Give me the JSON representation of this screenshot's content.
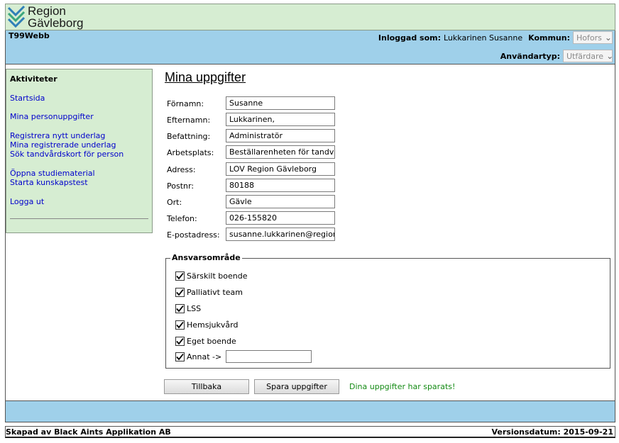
{
  "logo": {
    "line1": "Region",
    "line2": "Gävleborg"
  },
  "header": {
    "app_name": "T99Webb",
    "logged_in_label": "Inloggad som:",
    "logged_in_user": "Lukkarinen Susanne",
    "kommun_label": "Kommun:",
    "kommun_value": "Hofors",
    "usertype_label": "Användartyp:",
    "usertype_value": "Utfärdare"
  },
  "sidebar": {
    "title": "Aktiviteter",
    "items": [
      "Startsida",
      "Mina personuppgifter",
      "Registrera nytt underlag",
      "Mina registrerade underlag",
      "Sök tandvårdskort för person",
      "Öppna studiematerial",
      "Starta kunskapstest",
      "Logga ut"
    ]
  },
  "page": {
    "title": "Mina uppgifter"
  },
  "form": {
    "fields": [
      {
        "label": "Förnamn:",
        "value": "Susanne"
      },
      {
        "label": "Efternamn:",
        "value": "Lukkarinen,"
      },
      {
        "label": "Befattning:",
        "value": "Administratör"
      },
      {
        "label": "Arbetsplats:",
        "value": "Beställarenheten för tandvård"
      },
      {
        "label": "Adress:",
        "value": "LOV Region Gävleborg"
      },
      {
        "label": "Postnr:",
        "value": "80188"
      },
      {
        "label": "Ort:",
        "value": "Gävle"
      },
      {
        "label": "Telefon:",
        "value": "026-155820"
      },
      {
        "label": "E-postadress:",
        "value": "susanne.lukkarinen@regiongavleborg.se"
      }
    ]
  },
  "ansvar": {
    "legend": "Ansvarsområde",
    "items": [
      {
        "label": "Särskilt boende",
        "checked": true
      },
      {
        "label": "Palliativt team",
        "checked": true
      },
      {
        "label": "LSS",
        "checked": true
      },
      {
        "label": "Hemsjukvård",
        "checked": true
      },
      {
        "label": "Eget boende",
        "checked": true
      },
      {
        "label": "Annat ->",
        "checked": true
      }
    ],
    "annat_value": ""
  },
  "buttons": {
    "back": "Tillbaka",
    "save": "Spara uppgifter"
  },
  "status": {
    "saved": "Dina uppgifter har sparats!"
  },
  "footer": {
    "left": "Skapad av Black Aints Applikation AB",
    "right": "Versionsdatum: 2015-09-21"
  },
  "colors": {
    "green_bg": "#d6edd2",
    "blue_bg": "#9fd0ea",
    "link": "#0000cc",
    "success": "#138a13"
  }
}
